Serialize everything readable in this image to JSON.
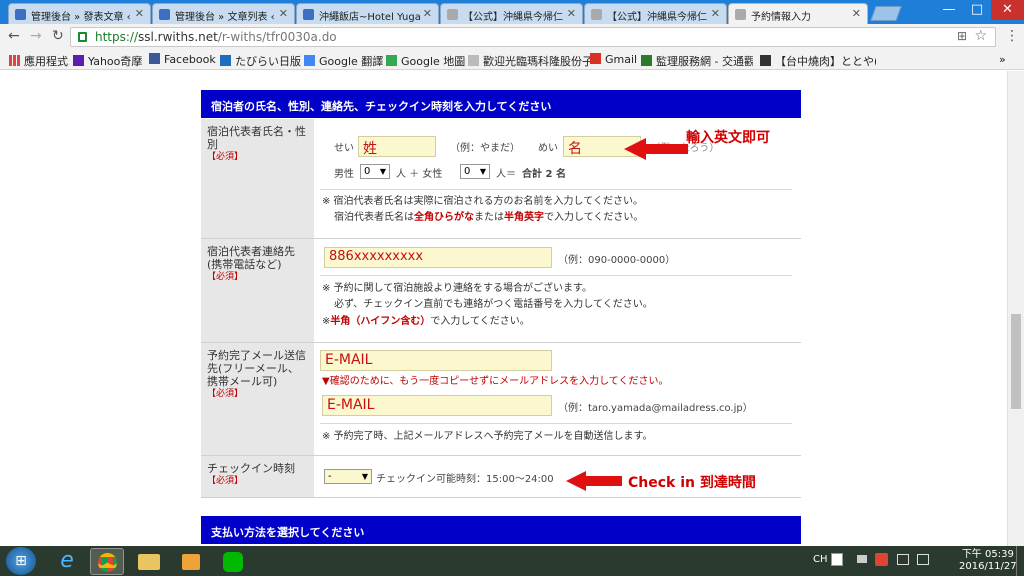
{
  "tabs": [
    {
      "label": "管理後台 » 發表文章 ‹",
      "fav": "#3a6fc4"
    },
    {
      "label": "管理後台 » 文章列表 ‹",
      "fav": "#3a6fc4"
    },
    {
      "label": "沖繩飯店~Hotel Yuga",
      "fav": "#3a6fc4"
    },
    {
      "label": "【公式】沖縄県今帰仁",
      "fav": "#aaaaaa"
    },
    {
      "label": "【公式】沖縄県今帰仁",
      "fav": "#aaaaaa"
    },
    {
      "label": "予約情報入力",
      "fav": "#aaaaaa"
    }
  ],
  "window": {
    "minimize": "—",
    "maximize": "□",
    "close": "✕"
  },
  "toolbar": {
    "back": "←",
    "forward": "→",
    "reload": "↻",
    "url_https": "https://",
    "url_domain": "ssl.rwiths.net",
    "url_path": "/r-withs/tfr0030a.do",
    "translate": "⊞",
    "star": "☆",
    "menu": "⋮"
  },
  "bookmarks": [
    {
      "label": "應用程式",
      "icon": "apps-icon",
      "color": "#d44"
    },
    {
      "label": "Yahoo奇摩",
      "icon": "yahoo-icon",
      "color": "#5b1dac"
    },
    {
      "label": "Facebook",
      "icon": "facebook-icon",
      "color": "#3b5998"
    },
    {
      "label": "たびらい日版",
      "icon": "tabirai-icon",
      "color": "#1b6fbf"
    },
    {
      "label": "Google 翻譯",
      "icon": "google-translate-icon",
      "color": "#4285f4"
    },
    {
      "label": "Google 地圖",
      "icon": "google-maps-icon",
      "color": "#34a853"
    },
    {
      "label": "歡迎光臨瑪科隆股份子",
      "icon": "page-icon",
      "color": "#999"
    },
    {
      "label": "Gmail",
      "icon": "gmail-icon",
      "color": "#d93025"
    },
    {
      "label": "監理服務網 - 交通觀",
      "icon": "gov-icon",
      "color": "#2a7a2a"
    },
    {
      "label": "【台中燒肉】ととや(",
      "icon": "restaurant-icon",
      "color": "#333"
    }
  ],
  "bookmarks_more": "»",
  "form": {
    "header1": "宿泊者の氏名、性別、連絡先、チェックイン時刻を入力してください",
    "required": "【必須】",
    "name_label": "宿泊代表者氏名・性別",
    "sei_label": "せい",
    "sei_value": "姓",
    "sei_example": "（例：やまだ）",
    "mei_label": "めい",
    "mei_value": "名",
    "mei_example": "（例：たろう）",
    "male_label": "男性",
    "male_value": "0",
    "person_plus": "人 ＋ 女性",
    "female_value": "0",
    "person_eq": "人＝",
    "total_label": "合計",
    "total_value": "2",
    "total_unit": "名",
    "name_note1": "※ 宿泊代表者氏名は実際に宿泊される方のお名前を入力してください。",
    "name_note2a": "宿泊代表者氏名は",
    "name_note2b": "全角ひらがな",
    "name_note2c": "または",
    "name_note2d": "半角英字",
    "name_note2e": "で入力してください。",
    "tel_label": "宿泊代表者連絡先(携帯電話など)",
    "tel_value": "886xxxxxxxxx",
    "tel_example": "（例：090-0000-0000）",
    "tel_note1": "※ 予約に関して宿泊施設より連絡をする場合がございます。",
    "tel_note2": "必ず、チェックイン直前でも連絡がつく電話番号を入力してください。",
    "tel_note3a": "※",
    "tel_note3b": "半角（ハイフン含む）",
    "tel_note3c": "で入力してください。",
    "mail_label": "予約完了メール送信先(フリーメール、携帯メール可)",
    "mail_value1": "E-MAIL",
    "mail_note": "▼確認のために、もう一度コピーせずにメールアドレスを入力してください。",
    "mail_value2": "E-MAIL",
    "mail_example": "（例：taro.yamada@mailadress.co.jp）",
    "mail_note2": "※ 予約完了時、上記メールアドレスへ予約完了メールを自動送信します。",
    "checkin_label": "チェックイン時刻",
    "checkin_value": "-",
    "checkin_range": "チェックイン可能時刻：15:00〜24:00",
    "header2": "支払い方法を選択してください"
  },
  "annotations": {
    "name_hint": "輸入英文即可",
    "checkin_hint": "Check in 到達時間"
  },
  "taskbar": {
    "start": "⊞",
    "ie": "e",
    "tray_lang": "CH",
    "tray_time": "下午 05:39",
    "tray_date": "2016/11/27"
  }
}
